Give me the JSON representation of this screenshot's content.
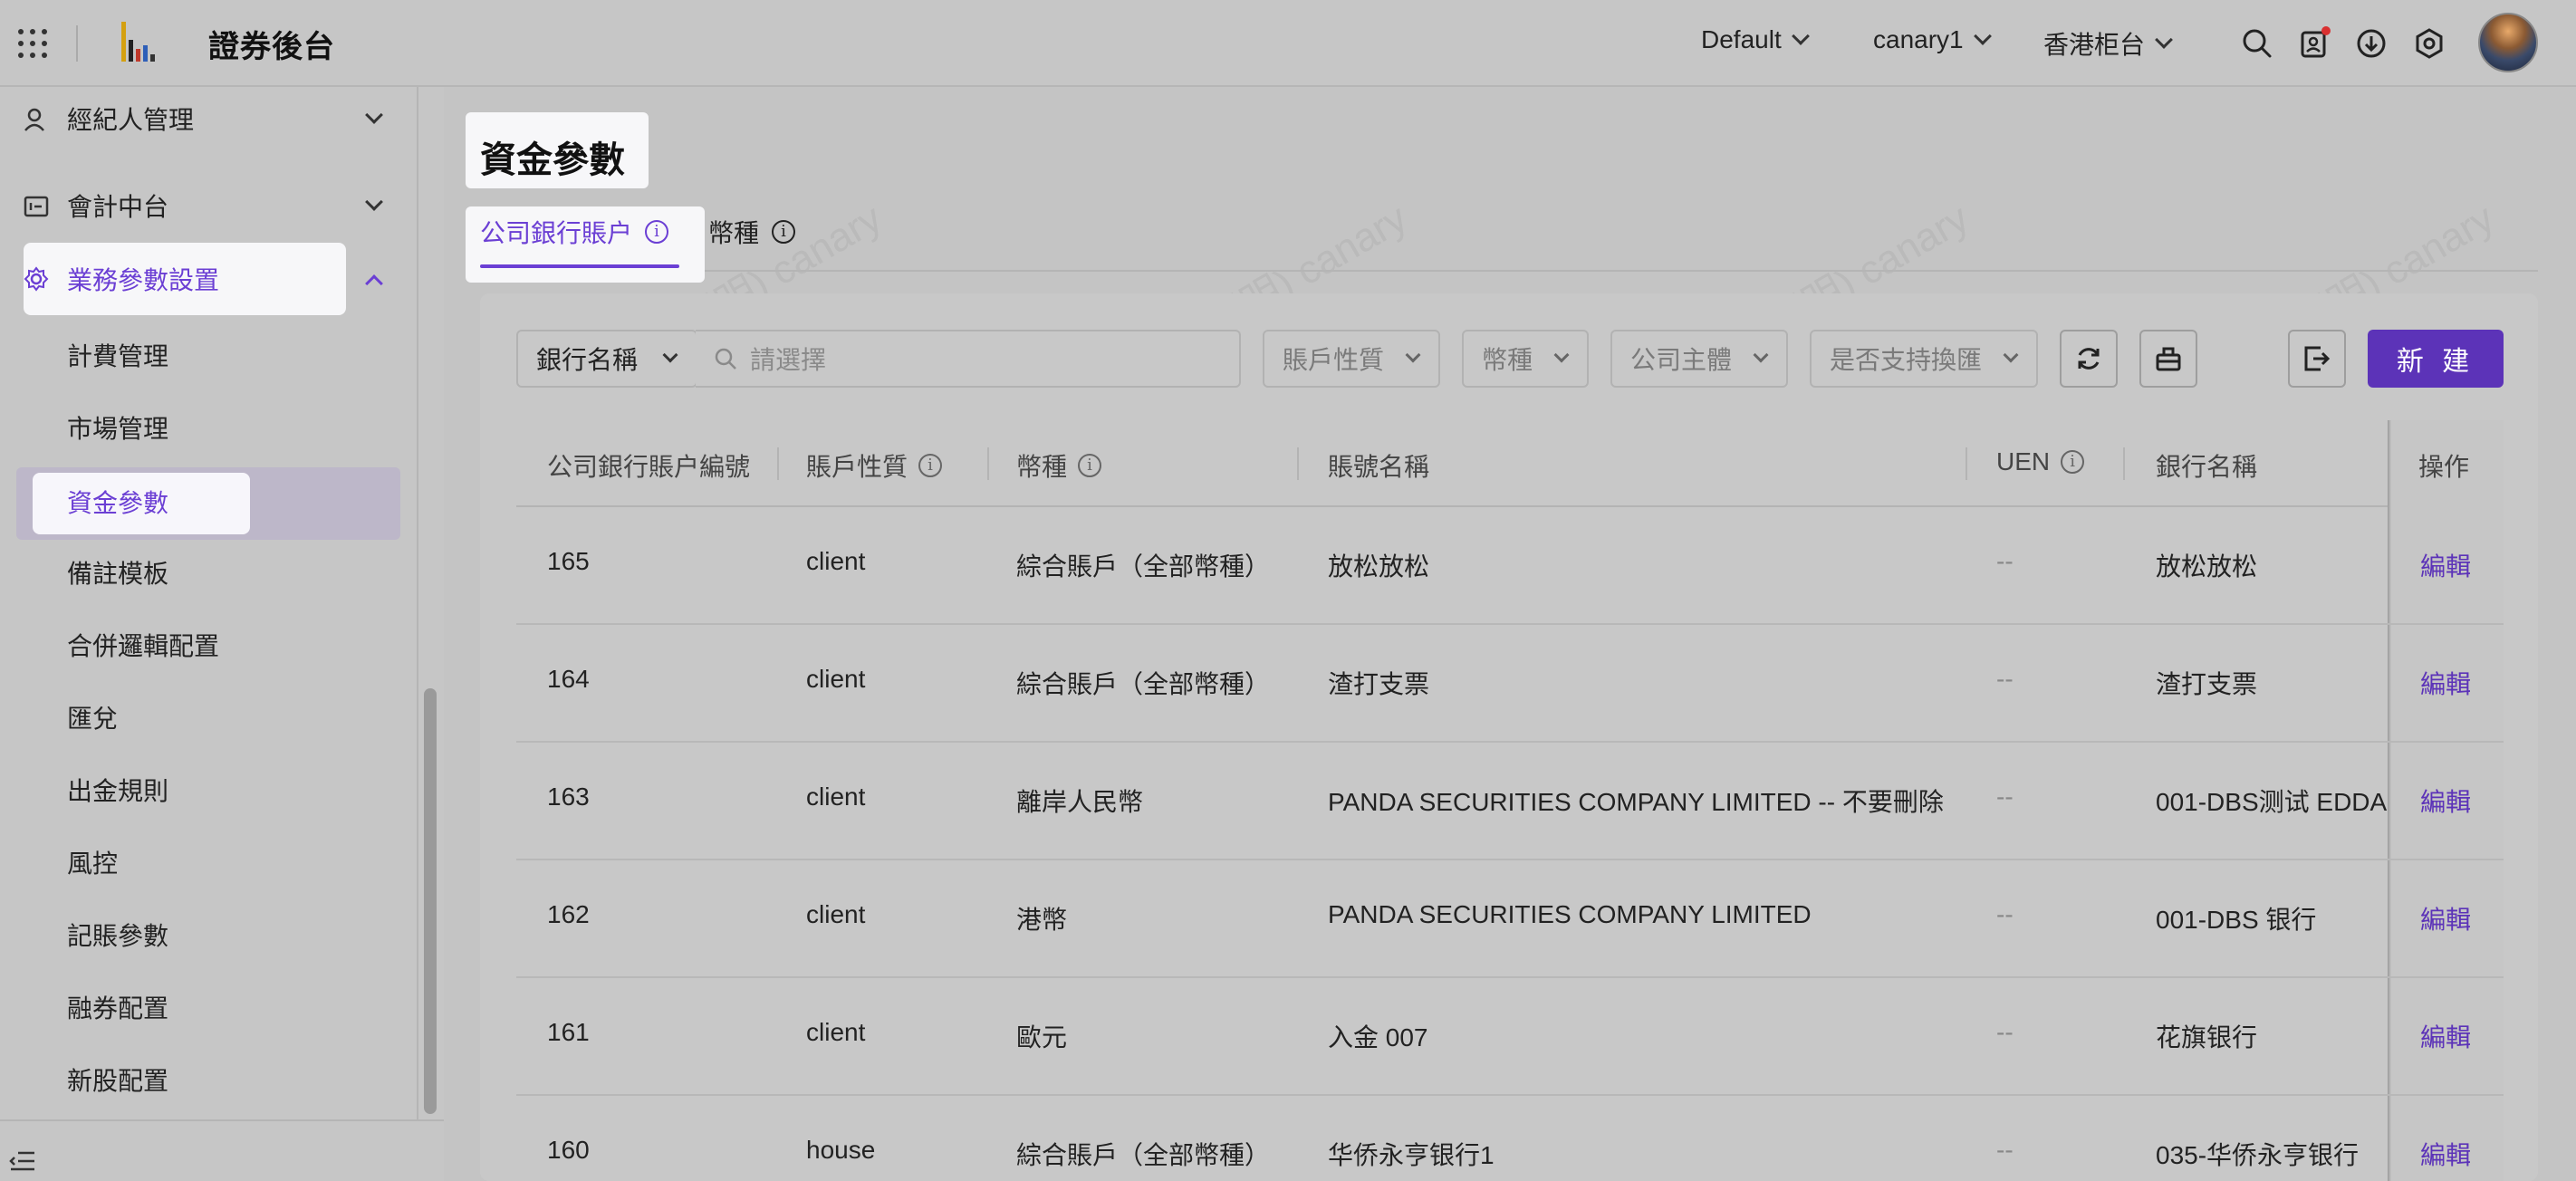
{
  "header": {
    "app_title": "證券後台",
    "selects": [
      "Default",
      "canary1",
      "香港柜台"
    ],
    "icons": [
      "search-icon",
      "user-notification-icon",
      "download-icon",
      "settings-icon"
    ]
  },
  "sidebar": {
    "groups": [
      {
        "label": "經紀人管理",
        "icon": "user-icon",
        "expanded": false
      },
      {
        "label": "會計中台",
        "icon": "ledger-icon",
        "expanded": false
      },
      {
        "label": "業務參數設置",
        "icon": "gear-icon",
        "expanded": true
      }
    ],
    "items": [
      {
        "label": "計費管理"
      },
      {
        "label": "市場管理"
      },
      {
        "label": "資金參數",
        "selected": true
      },
      {
        "label": "備註模板"
      },
      {
        "label": "合併邏輯配置"
      },
      {
        "label": "匯兌"
      },
      {
        "label": "出金規則"
      },
      {
        "label": "風控"
      },
      {
        "label": "記賬參數"
      },
      {
        "label": "融券配置"
      },
      {
        "label": "新股配置"
      }
    ]
  },
  "page": {
    "title": "資金參數",
    "tabs": [
      {
        "label": "公司銀行賬户",
        "active": true
      },
      {
        "label": "幣種",
        "active": false
      }
    ]
  },
  "filters": {
    "bank_select": "銀行名稱",
    "search_placeholder": "請選擇",
    "account_type": "賬戶性質",
    "currency": "幣種",
    "company": "公司主體",
    "fx_support": "是否支持換匯",
    "new_button": "新 建"
  },
  "table": {
    "headers": [
      "公司銀行賬户編號",
      "賬戶性質",
      "幣種",
      "賬號名稱",
      "UEN",
      "銀行名稱",
      "操作"
    ],
    "rows": [
      {
        "id": "165",
        "type": "client",
        "currency": "綜合賬戶（全部幣種）",
        "name": "放松放松",
        "uen": "--",
        "bank": "放松放松",
        "op": "編輯"
      },
      {
        "id": "164",
        "type": "client",
        "currency": "綜合賬戶（全部幣種）",
        "name": "渣打支票",
        "uen": "--",
        "bank": "渣打支票",
        "op": "編輯"
      },
      {
        "id": "163",
        "type": "client",
        "currency": "離岸人民幣",
        "name": "PANDA SECURITIES COMPANY LIMITED -- 不要刪除",
        "uen": "--",
        "bank": "001-DBS测试 EDDA",
        "op": "編輯"
      },
      {
        "id": "162",
        "type": "client",
        "currency": "港幣",
        "name": "PANDA SECURITIES COMPANY LIMITED",
        "uen": "--",
        "bank": "001-DBS 银行",
        "op": "編輯"
      },
      {
        "id": "161",
        "type": "client",
        "currency": "歐元",
        "name": "入金 007",
        "uen": "--",
        "bank": "花旗银行",
        "op": "編輯"
      },
      {
        "id": "160",
        "type": "house",
        "currency": "綜合賬戶（全部幣種）",
        "name": "华侨永亨银行1",
        "uen": "--",
        "bank": "035-华侨永亨银行",
        "op": "編輯"
      }
    ]
  },
  "watermark": "叛机(嵇明明) canary",
  "colors": {
    "accent": "#6b3fd4",
    "primary_button": "#5c33b8"
  }
}
